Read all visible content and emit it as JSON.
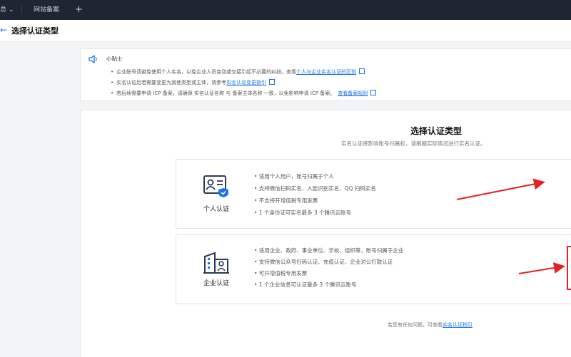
{
  "topbar": {
    "left_label": "总 ⌄",
    "tab": "网站备案",
    "add": "+"
  },
  "subheader": {
    "back_icon": "arrow-left-icon",
    "title": "选择认证类型"
  },
  "tips": {
    "title": "小贴士",
    "lines": [
      {
        "text": "企业账号请避免使用个人实名，以免企业人员变动或交接引起不必要的纠纷。查看",
        "link": "个人与企业实名认证的区别"
      },
      {
        "text": "实名认证后若需要变更为其他类型或主体，请参考",
        "link": "实名认证变更指引"
      },
      {
        "text": "若后续需要申请 ICP 备案，请确保 实名认证名称 与 备案主体名称 一致，以免影响申请 ICP 备案。",
        "link": "查看备案规则"
      }
    ]
  },
  "main": {
    "heading": "选择认证类型",
    "subheading": "实名认证将影响账号归属权，请根据实际情况进行实名认证。"
  },
  "cards": [
    {
      "label": "个人认证",
      "icon": "id-card-icon",
      "features": [
        "• 适用个人用户，账号归属于个人",
        "• 支持微信扫码实名、人脸识别实名、QQ 扫码实名",
        "• 不支持开增值税专用发票",
        "• 1 个身份证可实名最多 3 个腾讯云账号"
      ]
    },
    {
      "label": "企业认证",
      "icon": "building-icon",
      "features": [
        "• 适用企业、政府、事业单位、学校、组织等，账号归属于企业",
        "• 支持微信公众号扫码认证、充值认证、企业对公打款认证",
        "• 可开增值税专用发票",
        "• 1 个企业信息可认证最多 3 个腾讯云账号"
      ]
    }
  ],
  "footer": {
    "text": "若您有任何问题，可查看",
    "link": "实名认证指引"
  },
  "colors": {
    "accent": "#1a73e8",
    "annotation_red": "#e02424",
    "topbar_bg": "#1e2533"
  }
}
